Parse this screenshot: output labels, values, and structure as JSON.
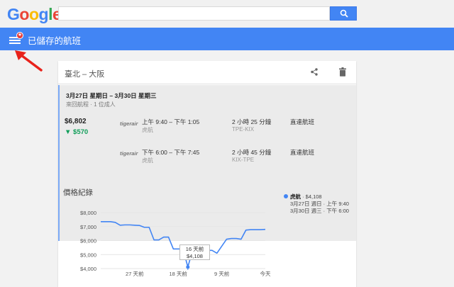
{
  "header": {
    "logo_letters": [
      {
        "char": "G",
        "color": "#4285f4"
      },
      {
        "char": "o",
        "color": "#ea4335"
      },
      {
        "char": "o",
        "color": "#fbbc05"
      },
      {
        "char": "g",
        "color": "#4285f4"
      },
      {
        "char": "l",
        "color": "#34a853"
      },
      {
        "char": "e",
        "color": "#ea4335"
      }
    ],
    "search_value": "",
    "search_icon": "search-icon"
  },
  "bar": {
    "title": "已儲存的航班",
    "menu_icon": "menu-icon",
    "color": "#4285f4"
  },
  "card": {
    "route": "臺北 – 大阪",
    "share_icon": "share-icon",
    "delete_icon": "trash-icon",
    "dates": "3月27日 星期日 – 3月30日 星期三",
    "trip_info": "來回航程 · 1 位成人",
    "price": "$6,802",
    "price_drop": "▼ $570",
    "drop_color": "#0f9d58",
    "legs": [
      {
        "airline": "tigerair",
        "time": "上午 9:40 – 下午 1:05",
        "carrier": "虎航",
        "duration": "2 小時 25 分鐘",
        "airports": "TPE-KIX",
        "stops": "直達航班"
      },
      {
        "airline": "tigerair",
        "time": "下午 6:00 – 下午 7:45",
        "carrier": "虎航",
        "duration": "2 小時 45 分鐘",
        "airports": "KIX-TPE",
        "stops": "直達航班"
      }
    ]
  },
  "history": {
    "title": "價格紀錄",
    "tooltip_line1": "16 天前",
    "tooltip_line2": "$4,108",
    "legend": {
      "airline": "虎航",
      "price": " · $4,108",
      "line1": "3月27日 週日 · 上午 9:40",
      "line2": "3月30日 週三 · 下午 6:00"
    }
  },
  "chart_data": {
    "type": "line",
    "title": "價格紀錄",
    "xlabel": "",
    "ylabel": "",
    "ylim": [
      4000,
      8000
    ],
    "y_ticks": [
      "$8,000",
      "$7,000",
      "$6,000",
      "$5,000",
      "$4,000"
    ],
    "x_ticks": [
      "27 天前",
      "18 天前",
      "9 天前",
      "今天"
    ],
    "x_range_days_ago": [
      34,
      0
    ],
    "grid": true,
    "series": [
      {
        "name": "虎航",
        "color": "#4285f4",
        "x_days_ago": [
          34,
          32,
          31,
          30,
          29,
          28,
          27,
          26,
          25,
          24,
          23,
          22,
          21,
          20,
          19,
          18,
          17,
          16,
          15,
          14,
          13,
          12,
          11,
          10,
          9,
          8,
          7,
          6,
          5,
          4,
          3,
          2,
          1,
          0
        ],
        "values": [
          7350,
          7350,
          7300,
          7100,
          7120,
          7120,
          7100,
          7080,
          6950,
          6950,
          6050,
          6050,
          6250,
          6250,
          5400,
          5400,
          5400,
          4108,
          5350,
          5350,
          5300,
          5300,
          5300,
          5100,
          5600,
          6100,
          6150,
          6150,
          6100,
          6750,
          6780,
          6780,
          6780,
          6800
        ]
      }
    ],
    "highlight": {
      "days_ago": 16,
      "value": 4108
    }
  }
}
